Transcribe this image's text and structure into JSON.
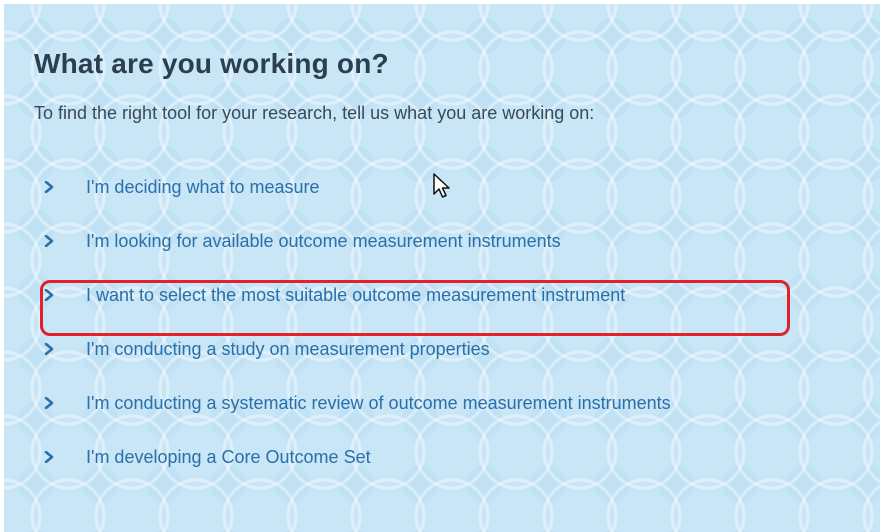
{
  "header": {
    "title": "What are you working on?",
    "intro": "To find the right tool for your research, tell us what you are working on:"
  },
  "options": [
    {
      "label": "I'm deciding what to measure",
      "icon": "chevron-right-icon"
    },
    {
      "label": "I'm looking for available outcome measurement instruments",
      "icon": "chevron-right-icon"
    },
    {
      "label": "I want to select the most suitable outcome measurement instrument",
      "icon": "chevron-right-icon",
      "highlighted": true
    },
    {
      "label": "I'm conducting a study on measurement properties",
      "icon": "chevron-right-icon"
    },
    {
      "label": "I'm conducting a systematic review of outcome measurement instruments",
      "icon": "chevron-right-icon"
    },
    {
      "label": "I'm developing a Core Outcome Set",
      "icon": "chevron-right-icon"
    }
  ],
  "colors": {
    "background": "#c9e6f7",
    "heading": "#2a3f4f",
    "link": "#2a6fa8",
    "highlight_border": "#e0222a"
  }
}
